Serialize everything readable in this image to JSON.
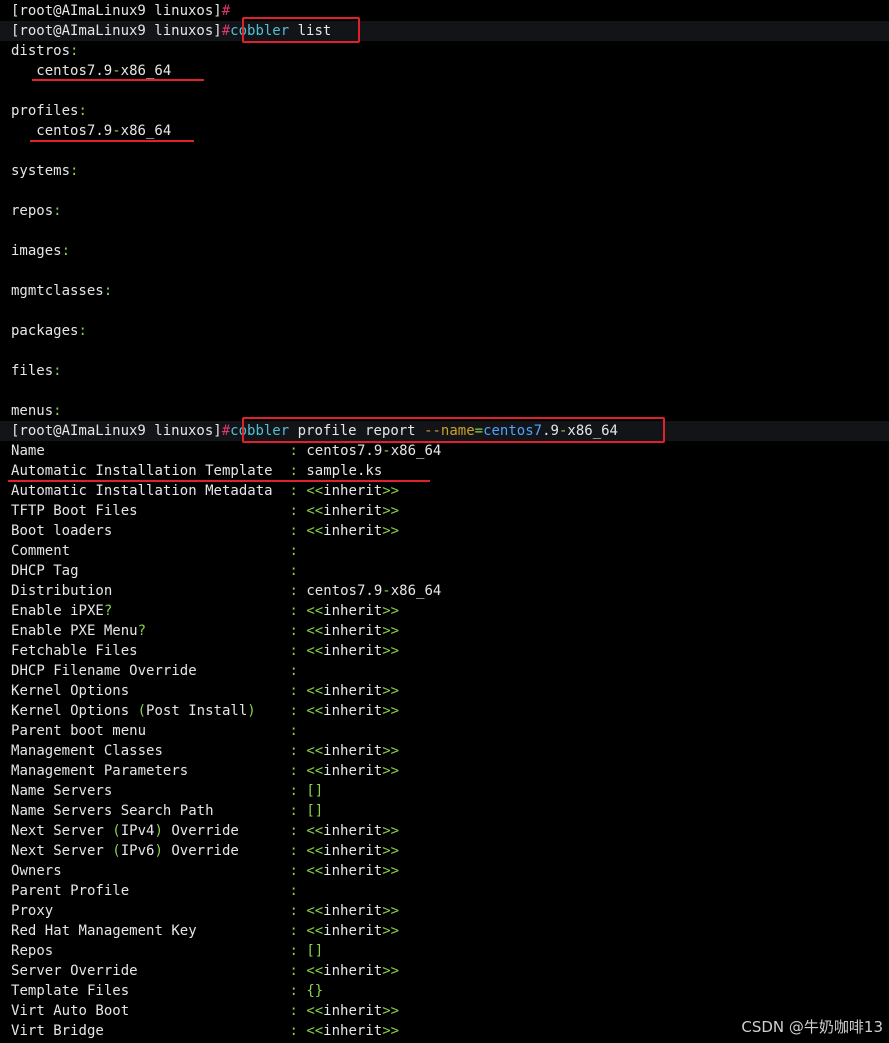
{
  "prompt": {
    "text": "[root@AImaLinux9 linuxos]",
    "hash": "#"
  },
  "commands": {
    "cobbler_list": {
      "cmd": "cobbler",
      "arg": "list"
    },
    "profile_report": {
      "cmd": "cobbler",
      "args": "profile report",
      "flag": "--name",
      "eq": "=",
      "value_blue": "centos7",
      "value_sep": ".",
      "value_num": "9",
      "value_dash": "-",
      "value_tail": "x86_64"
    }
  },
  "list_output": {
    "distros": {
      "label": "distros",
      "item": "centos7.9-x86_64"
    },
    "profiles": {
      "label": "profiles",
      "item": "centos7.9-x86_64"
    },
    "empty_sections": [
      "systems",
      "repos",
      "images",
      "mgmtclasses",
      "packages",
      "files",
      "menus"
    ]
  },
  "report_rows": [
    {
      "key": "Name",
      "value": "centos7.9-x86_64"
    },
    {
      "key": "Automatic Installation Template",
      "value": "sample.ks"
    },
    {
      "key": "Automatic Installation Metadata",
      "value": "<<inherit>>"
    },
    {
      "key": "TFTP Boot Files",
      "value": "<<inherit>>"
    },
    {
      "key": "Boot loaders",
      "value": "<<inherit>>"
    },
    {
      "key": "Comment",
      "value": ""
    },
    {
      "key": "DHCP Tag",
      "value": ""
    },
    {
      "key": "Distribution",
      "value": "centos7.9-x86_64"
    },
    {
      "key": "Enable iPXE?",
      "value": "<<inherit>>"
    },
    {
      "key": "Enable PXE Menu?",
      "value": "<<inherit>>"
    },
    {
      "key": "Fetchable Files",
      "value": "<<inherit>>"
    },
    {
      "key": "DHCP Filename Override",
      "value": ""
    },
    {
      "key": "Kernel Options",
      "value": "<<inherit>>"
    },
    {
      "key": "Kernel Options (Post Install)",
      "value": "<<inherit>>"
    },
    {
      "key": "Parent boot menu",
      "value": ""
    },
    {
      "key": "Management Classes",
      "value": "<<inherit>>"
    },
    {
      "key": "Management Parameters",
      "value": "<<inherit>>"
    },
    {
      "key": "Name Servers",
      "value": "[]"
    },
    {
      "key": "Name Servers Search Path",
      "value": "[]"
    },
    {
      "key": "Next Server (IPv4) Override",
      "value": "<<inherit>>"
    },
    {
      "key": "Next Server (IPv6) Override",
      "value": "<<inherit>>"
    },
    {
      "key": "Owners",
      "value": "<<inherit>>"
    },
    {
      "key": "Parent Profile",
      "value": ""
    },
    {
      "key": "Proxy",
      "value": "<<inherit>>"
    },
    {
      "key": "Red Hat Management Key",
      "value": "<<inherit>>"
    },
    {
      "key": "Repos",
      "value": "[]"
    },
    {
      "key": "Server Override",
      "value": "<<inherit>>"
    },
    {
      "key": "Template Files",
      "value": "{}"
    },
    {
      "key": "Virt Auto Boot",
      "value": "<<inherit>>"
    },
    {
      "key": "Virt Bridge",
      "value": "<<inherit>>"
    }
  ],
  "separator": ":",
  "watermark": "CSDN @牛奶咖啡13",
  "colors": {
    "background": "#000000",
    "prompt_hash": "#e0366f",
    "command": "#4fc1d6",
    "flag": "#c9a227",
    "accent": "#8bd24a",
    "highlight_box": "#e0202a"
  }
}
